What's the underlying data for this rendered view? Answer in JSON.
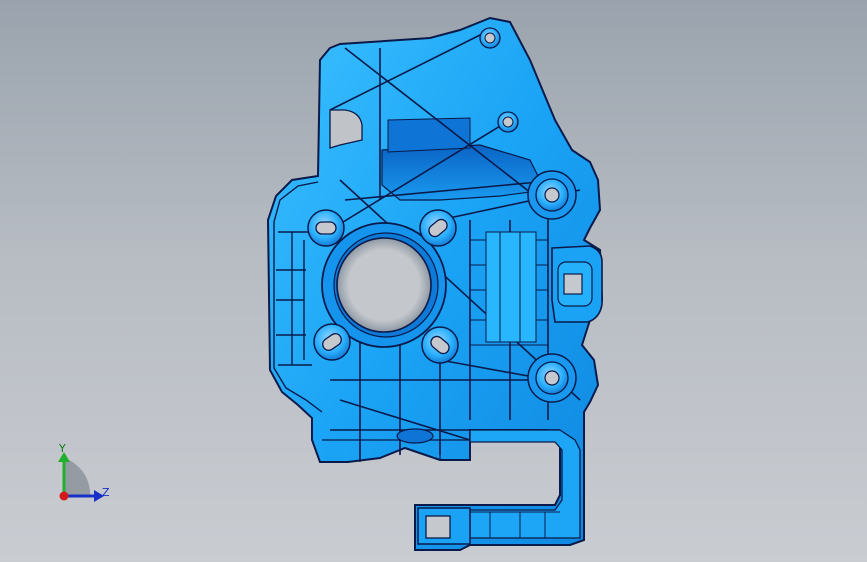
{
  "viewport": {
    "background_top": "#9aa3ad",
    "background_bottom": "#c9ccd1"
  },
  "model": {
    "part_color": "#1aa3f5",
    "edge_color": "#0a1a4a",
    "shadow_color": "#0b63b8",
    "highlight_color": "#5fd0ff"
  },
  "triad": {
    "y_label": "Y",
    "z_label": "Z",
    "y_color": "#22b02c",
    "z_color": "#1630c8",
    "x_color": "#d21a1a"
  }
}
